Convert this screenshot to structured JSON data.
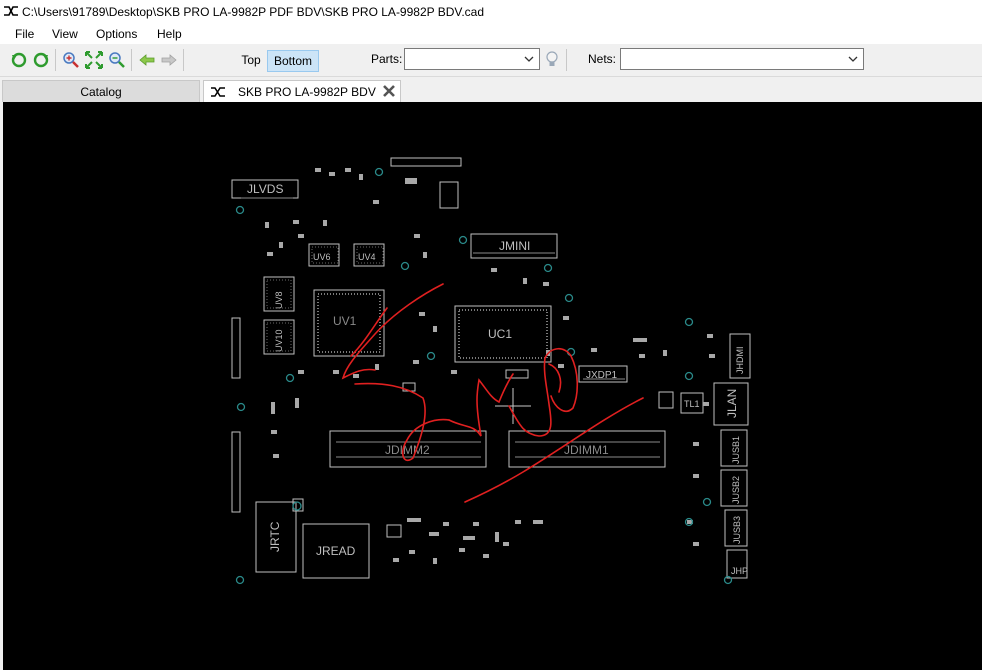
{
  "window": {
    "title": "C:\\Users\\91789\\Desktop\\SKB PRO LA-9982P PDF BDV\\SKB PRO LA-9982P BDV.cad"
  },
  "menu": {
    "items": [
      "File",
      "View",
      "Options",
      "Help"
    ]
  },
  "toolbar": {
    "side_top": "Top",
    "side_bottom": "Bottom",
    "side_selected": "Bottom",
    "parts_label": "Parts:",
    "parts_value": "",
    "nets_label": "Nets:",
    "nets_value": ""
  },
  "tabs": [
    {
      "label": "Catalog",
      "active": false
    },
    {
      "label": "SKB PRO LA-9982P BDV",
      "active": true
    }
  ],
  "board": {
    "background": "#000000",
    "outline_color": "#bfbfbf",
    "markup_color": "#e02020",
    "labels": {
      "jlvds": "JLVDS",
      "jmini": "JMINI",
      "uv6": "UV6",
      "uv4": "UV4",
      "uv8": "UV8",
      "uv10": "UV10",
      "uv1": "UV1",
      "uc1": "UC1",
      "jxdp1": "JXDP1",
      "jhdmi": "JHDMI",
      "tl1": "TL1",
      "jlan": "JLAN",
      "jusb1": "JUSB1",
      "jusb2": "JUSB2",
      "jusb3": "JUSB3",
      "jhp": "JHP",
      "jdimm2": "JDIMM2",
      "jdimm1": "JDIMM1",
      "jrtc": "JRTC",
      "jread": "JREAD"
    }
  }
}
